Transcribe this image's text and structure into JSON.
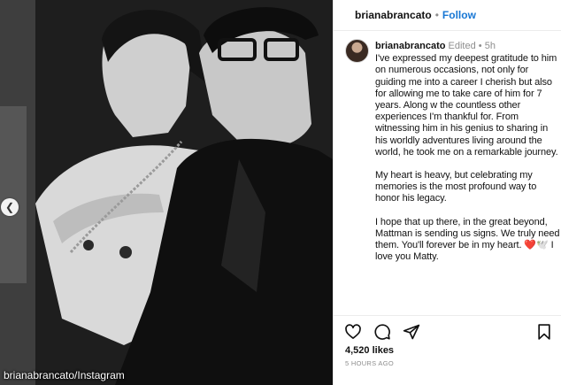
{
  "photo": {
    "credit": "brianabrancato/Instagram",
    "prev_icon": "chevron-left-icon"
  },
  "header": {
    "username": "brianabrancato",
    "separator": "•",
    "follow": "Follow"
  },
  "caption": {
    "username": "brianabrancato",
    "edited": "Edited",
    "separator": "•",
    "age": "5h",
    "paragraphs": [
      "I've expressed my deepest gratitude to him on numerous occasions, not only for guiding me into a career I cherish but also for allowing me to take care of him for 7 years. Along w the countless other experiences I'm thankful for. From witnessing him in his genius to sharing in his worldly adventures living around the world, he took me on a remarkable journey.",
      "My heart is heavy, but celebrating my memories is the most profound way to honor his legacy.",
      "I hope that up there, in the great beyond, Mattman is sending us signs. We truly need them. You'll forever be in my heart."
    ],
    "emoji": "❤️🕊️",
    "closing": "I love you Matty."
  },
  "actions": {
    "icons": [
      "heart-icon",
      "comment-icon",
      "share-icon",
      "bookmark-icon"
    ]
  },
  "likes": "4,520 likes",
  "timestamp": "5 HOURS AGO",
  "colors": {
    "follow": "#1877d4",
    "muted": "#8e8e8e",
    "heart": "#e0243b"
  }
}
